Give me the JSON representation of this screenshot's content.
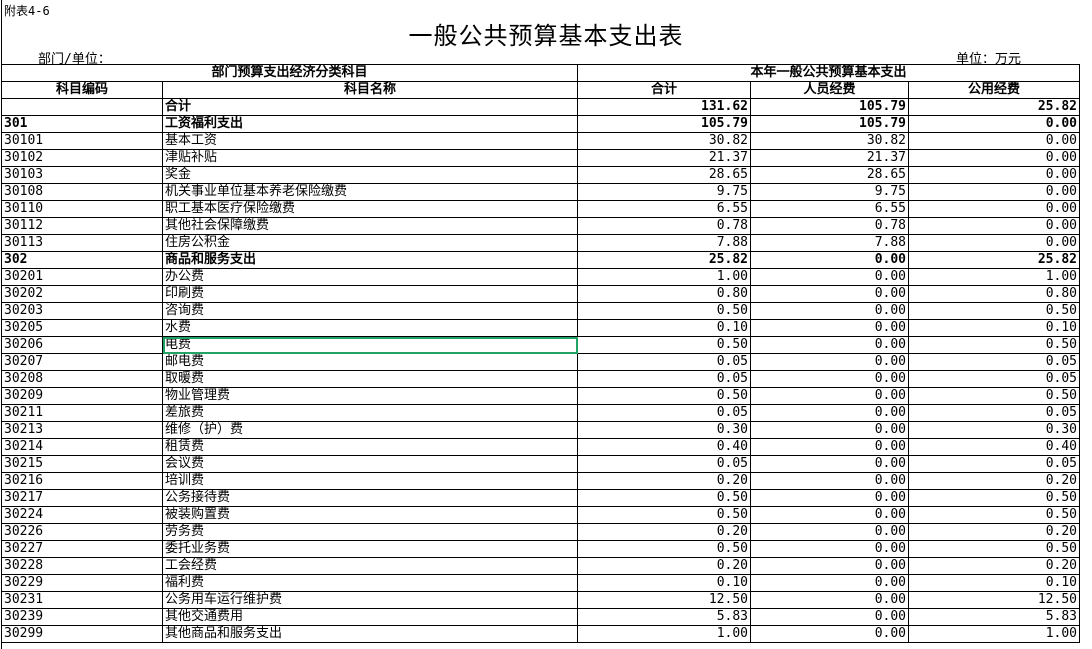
{
  "sheet": {
    "ref": "附表4-6",
    "title": "一般公共预算基本支出表",
    "department_label": "部门/单位：",
    "unit_label": "单位：万元"
  },
  "header": {
    "group_left": "部门预算支出经济分类科目",
    "group_right": "本年一般公共预算基本支出",
    "code": "科目编码",
    "name": "科目名称",
    "total": "合计",
    "personnel": "人员经费",
    "public": "公用经费"
  },
  "total_row": {
    "label": "合计",
    "total": "131.62",
    "personnel": "105.79",
    "public": "25.82"
  },
  "rows": [
    {
      "code": "301",
      "name": "工资福利支出",
      "total": "105.79",
      "personnel": "105.79",
      "public": "0.00",
      "bold": true
    },
    {
      "code": "30101",
      "name": "基本工资",
      "total": "30.82",
      "personnel": "30.82",
      "public": "0.00"
    },
    {
      "code": "30102",
      "name": "津贴补贴",
      "total": "21.37",
      "personnel": "21.37",
      "public": "0.00"
    },
    {
      "code": "30103",
      "name": "奖金",
      "total": "28.65",
      "personnel": "28.65",
      "public": "0.00"
    },
    {
      "code": "30108",
      "name": "机关事业单位基本养老保险缴费",
      "total": "9.75",
      "personnel": "9.75",
      "public": "0.00"
    },
    {
      "code": "30110",
      "name": "职工基本医疗保险缴费",
      "total": "6.55",
      "personnel": "6.55",
      "public": "0.00"
    },
    {
      "code": "30112",
      "name": "其他社会保障缴费",
      "total": "0.78",
      "personnel": "0.78",
      "public": "0.00"
    },
    {
      "code": "30113",
      "name": "住房公积金",
      "total": "7.88",
      "personnel": "7.88",
      "public": "0.00"
    },
    {
      "code": "302",
      "name": "商品和服务支出",
      "total": "25.82",
      "personnel": "0.00",
      "public": "25.82",
      "bold": true
    },
    {
      "code": "30201",
      "name": "办公费",
      "total": "1.00",
      "personnel": "0.00",
      "public": "1.00"
    },
    {
      "code": "30202",
      "name": "印刷费",
      "total": "0.80",
      "personnel": "0.00",
      "public": "0.80"
    },
    {
      "code": "30203",
      "name": "咨询费",
      "total": "0.50",
      "personnel": "0.00",
      "public": "0.50"
    },
    {
      "code": "30205",
      "name": "水费",
      "total": "0.10",
      "personnel": "0.00",
      "public": "0.10"
    },
    {
      "code": "30206",
      "name": "电费",
      "total": "0.50",
      "personnel": "0.00",
      "public": "0.50",
      "selected": true
    },
    {
      "code": "30207",
      "name": "邮电费",
      "total": "0.05",
      "personnel": "0.00",
      "public": "0.05"
    },
    {
      "code": "30208",
      "name": "取暖费",
      "total": "0.05",
      "personnel": "0.00",
      "public": "0.05"
    },
    {
      "code": "30209",
      "name": "物业管理费",
      "total": "0.50",
      "personnel": "0.00",
      "public": "0.50"
    },
    {
      "code": "30211",
      "name": "差旅费",
      "total": "0.05",
      "personnel": "0.00",
      "public": "0.05"
    },
    {
      "code": "30213",
      "name": "维修（护）费",
      "total": "0.30",
      "personnel": "0.00",
      "public": "0.30"
    },
    {
      "code": "30214",
      "name": "租赁费",
      "total": "0.40",
      "personnel": "0.00",
      "public": "0.40"
    },
    {
      "code": "30215",
      "name": "会议费",
      "total": "0.05",
      "personnel": "0.00",
      "public": "0.05"
    },
    {
      "code": "30216",
      "name": "培训费",
      "total": "0.20",
      "personnel": "0.00",
      "public": "0.20"
    },
    {
      "code": "30217",
      "name": "公务接待费",
      "total": "0.50",
      "personnel": "0.00",
      "public": "0.50"
    },
    {
      "code": "30224",
      "name": "被装购置费",
      "total": "0.50",
      "personnel": "0.00",
      "public": "0.50"
    },
    {
      "code": "30226",
      "name": "劳务费",
      "total": "0.20",
      "personnel": "0.00",
      "public": "0.20"
    },
    {
      "code": "30227",
      "name": "委托业务费",
      "total": "0.50",
      "personnel": "0.00",
      "public": "0.50"
    },
    {
      "code": "30228",
      "name": "工会经费",
      "total": "0.20",
      "personnel": "0.00",
      "public": "0.20"
    },
    {
      "code": "30229",
      "name": "福利费",
      "total": "0.10",
      "personnel": "0.00",
      "public": "0.10"
    },
    {
      "code": "30231",
      "name": "公务用车运行维护费",
      "total": "12.50",
      "personnel": "0.00",
      "public": "12.50"
    },
    {
      "code": "30239",
      "name": "其他交通费用",
      "total": "5.83",
      "personnel": "0.00",
      "public": "5.83"
    },
    {
      "code": "30299",
      "name": "其他商品和服务支出",
      "total": "1.00",
      "personnel": "0.00",
      "public": "1.00"
    }
  ],
  "colors": {
    "selection": "#21a366",
    "grid": "#000000"
  }
}
